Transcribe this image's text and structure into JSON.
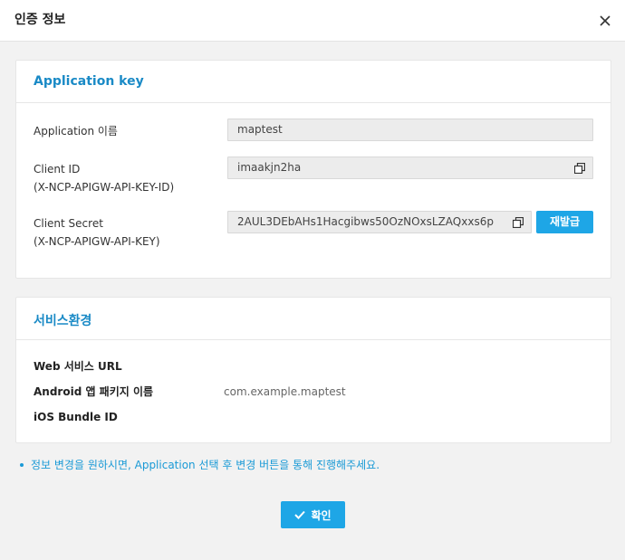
{
  "modal": {
    "title": "인증 정보"
  },
  "app_key": {
    "title": "Application key",
    "rows": [
      {
        "label": "Application 이름",
        "value": "maptest"
      },
      {
        "label_line1": "Client ID",
        "label_line2": "(X-NCP-APIGW-API-KEY-ID)",
        "value": "imaakjn2ha"
      },
      {
        "label_line1": "Client Secret",
        "label_line2": "(X-NCP-APIGW-API-KEY)",
        "value": "2AUL3DEbAHs1Hacgibws50OzNOxsLZAQxxs6p"
      }
    ],
    "reissue_label": "재발급"
  },
  "service_env": {
    "title": "서비스환경",
    "rows": [
      {
        "label": "Web 서비스 URL",
        "value": ""
      },
      {
        "label": "Android 앱 패키지 이름",
        "value": "com.example.maptest"
      },
      {
        "label": "iOS Bundle ID",
        "value": ""
      }
    ]
  },
  "notice": "정보 변경을 원하시면, Application 선택 후 변경 버튼을 통해 진행해주세요.",
  "confirm_label": "확인",
  "colors": {
    "accent": "#1ea6e6",
    "title_blue": "#1a8ac6"
  },
  "icons": {
    "close": "close-icon",
    "copy": "copy-icon",
    "check": "check-icon"
  }
}
